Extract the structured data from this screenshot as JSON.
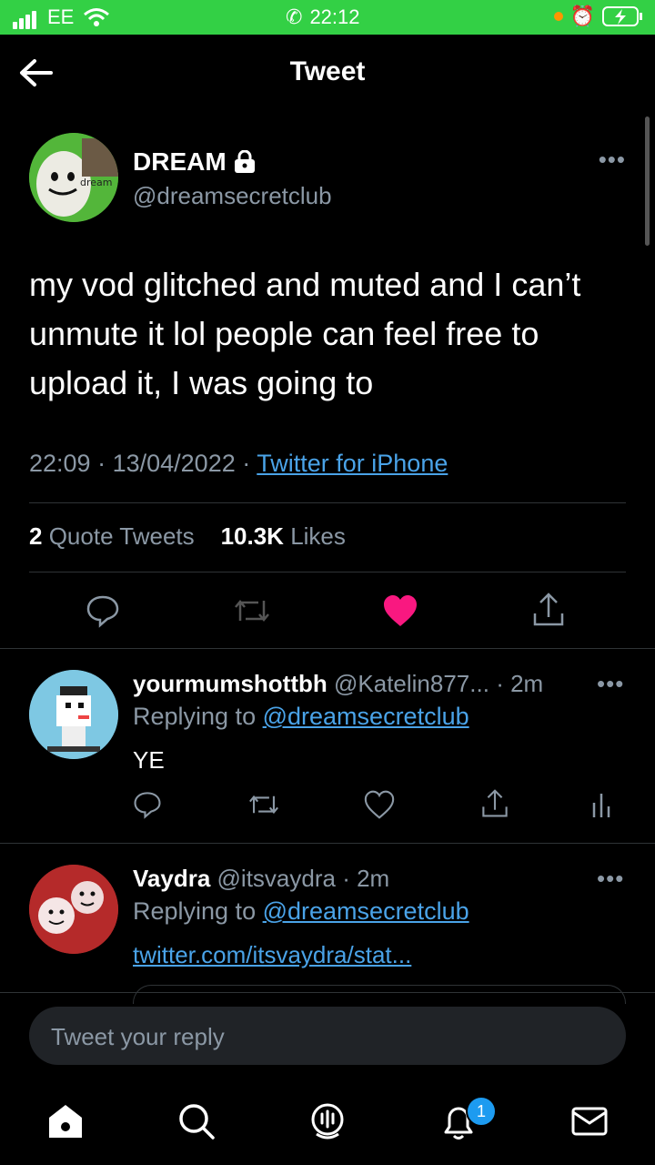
{
  "status_bar": {
    "carrier": "EE",
    "time": "22:12",
    "colors": {
      "background": "#33d045"
    }
  },
  "header": {
    "title": "Tweet"
  },
  "tweet": {
    "author_name": "DREAM",
    "author_handle": "@dreamsecretclub",
    "avatar_text": "dream",
    "text": "my vod glitched and muted and I can’t unmute it lol people can feel free to upload it, I was going to",
    "time": "22:09",
    "date": "13/04/2022",
    "source": "Twitter for iPhone",
    "quote_tweets_count": "2",
    "quote_tweets_label": "Quote Tweets",
    "likes_count": "10.3K",
    "likes_label": "Likes",
    "liked": true
  },
  "replies": [
    {
      "name": "yourmumshottbh",
      "handle": "@Katelin877...",
      "time": "2m",
      "replying_label": "Replying to",
      "replying_to": "@dreamsecretclub",
      "text": "YE"
    },
    {
      "name": "Vaydra",
      "handle": "@itsvaydra",
      "time": "2m",
      "replying_label": "Replying to",
      "replying_to": "@dreamsecretclub",
      "text": "twitter.com/itsvaydra/stat..."
    }
  ],
  "composer": {
    "placeholder": "Tweet your reply"
  },
  "tabbar": {
    "notifications_badge": "1"
  },
  "colors": {
    "accent": "#1d9bf0",
    "like": "#f91880",
    "link": "#4aa3e8",
    "muted": "#8b98a5"
  }
}
